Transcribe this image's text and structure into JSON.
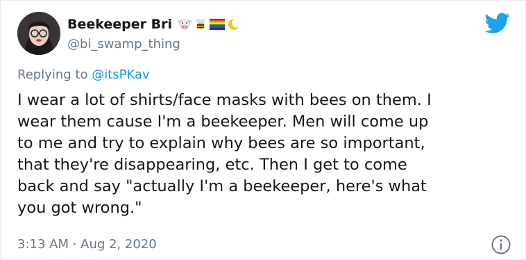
{
  "author": {
    "display_name": "Beekeeper Bri",
    "handle": "@bi_swamp_thing",
    "name_emojis": [
      "cow-face-icon",
      "bee-icon",
      "rainbow-flag-icon",
      "crescent-moon-icon"
    ]
  },
  "reply": {
    "prefix": "Replying to ",
    "mention": "@itsPKav"
  },
  "tweet": {
    "text": "I wear a lot of shirts/face masks with bees on them.  I\nwear them cause I'm a beekeeper.  Men will come up\nto me and try to explain why bees are so important,\nthat they're disappearing, etc.  Then I get to come\nback and say \"actually I'm a beekeeper, here's what\nyou got wrong.\""
  },
  "meta": {
    "time": "3:13 AM",
    "separator": " · ",
    "date": "Aug 2, 2020"
  },
  "colors": {
    "brand": "#1da1f2",
    "mention": "#1b95e0",
    "secondary_text": "#657786",
    "primary_text": "#14171a"
  }
}
